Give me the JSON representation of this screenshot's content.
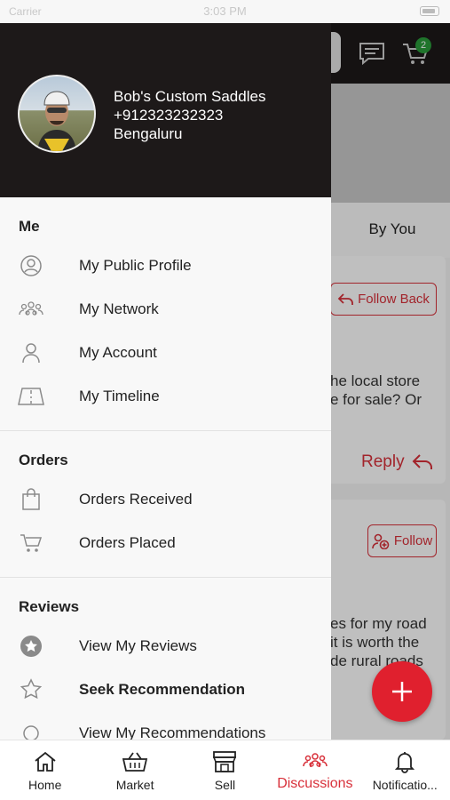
{
  "status_bar": {
    "carrier": "Carrier",
    "time": "3:03 PM"
  },
  "header": {
    "cart_badge": "2"
  },
  "background": {
    "tab_by_you": "By You",
    "follow_back_label": "Follow Back",
    "follow_label": "Follow",
    "reply_label": "Reply",
    "post1_line1": "he local store",
    "post1_line2": "e for sale? Or",
    "post2_line1": "es for my road",
    "post2_line2": "it is worth the",
    "post2_line3": "de rural roads"
  },
  "profile": {
    "name": "Bob's Custom Saddles",
    "phone": "+912323232323",
    "city": "Bengaluru"
  },
  "drawer": {
    "sections": [
      {
        "title": "Me",
        "items": [
          {
            "label": "My Public Profile",
            "icon": "user-circle-icon"
          },
          {
            "label": "My Network",
            "icon": "network-icon"
          },
          {
            "label": "My Account",
            "icon": "user-icon"
          },
          {
            "label": "My Timeline",
            "icon": "timeline-icon"
          }
        ]
      },
      {
        "title": "Orders",
        "items": [
          {
            "label": "Orders Received",
            "icon": "shopping-bag-icon"
          },
          {
            "label": "Orders Placed",
            "icon": "cart-icon"
          }
        ]
      },
      {
        "title": "Reviews",
        "items": [
          {
            "label": "View My Reviews",
            "icon": "star-filled-icon"
          },
          {
            "label": "Seek Recommendation",
            "icon": "star-outline-icon"
          },
          {
            "label": "View My Recommendations",
            "icon": "recommendation-icon"
          }
        ]
      }
    ]
  },
  "bottom_nav": [
    {
      "label": "Home",
      "icon": "home-icon"
    },
    {
      "label": "Market",
      "icon": "basket-icon"
    },
    {
      "label": "Sell",
      "icon": "store-icon"
    },
    {
      "label": "Discussions",
      "icon": "people-icon",
      "active": true
    },
    {
      "label": "Notificatio...",
      "icon": "bell-icon"
    }
  ],
  "colors": {
    "accent": "#d8303a",
    "header": "#1d1919",
    "badge": "#2a9b3a"
  }
}
